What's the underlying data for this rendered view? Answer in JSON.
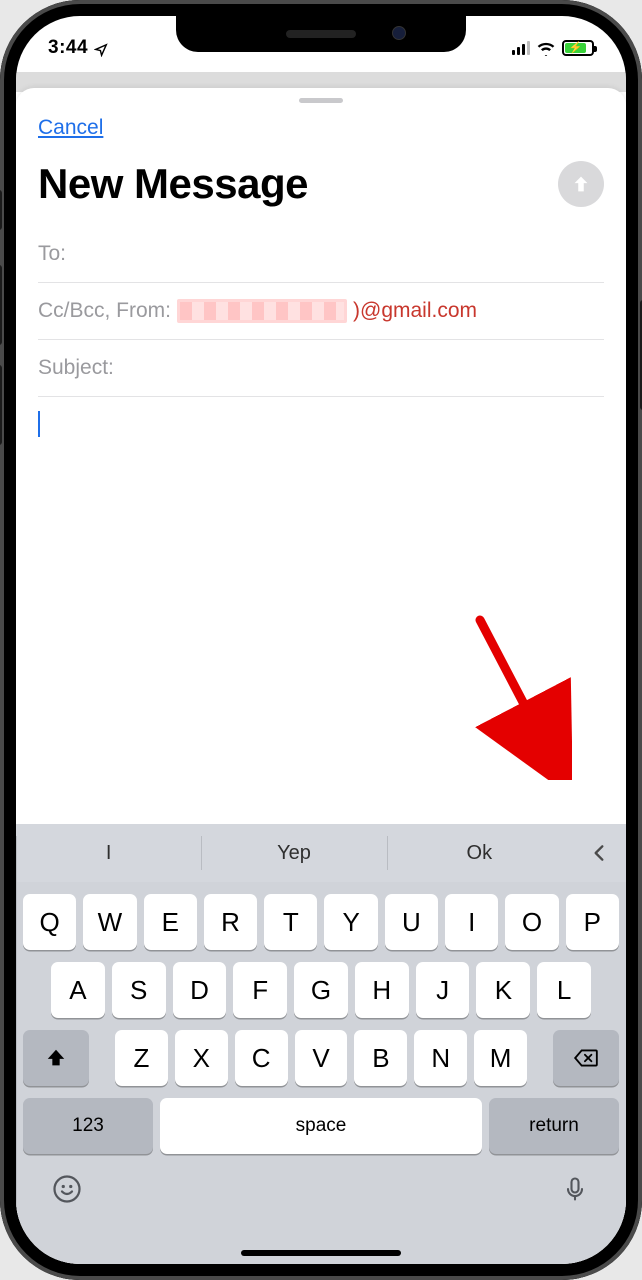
{
  "status": {
    "time": "3:44"
  },
  "sheet": {
    "cancel_label": "Cancel",
    "title": "New Message"
  },
  "fields": {
    "to_label": "To:",
    "ccbcc_from_label": "Cc/Bcc, From:",
    "from_domain_suffix": ")@gmail.com",
    "subject_label": "Subject:"
  },
  "suggestions": [
    "I",
    "Yep",
    "Ok"
  ],
  "keyboard": {
    "row1": [
      "Q",
      "W",
      "E",
      "R",
      "T",
      "Y",
      "U",
      "I",
      "O",
      "P"
    ],
    "row2": [
      "A",
      "S",
      "D",
      "F",
      "G",
      "H",
      "J",
      "K",
      "L"
    ],
    "row3": [
      "Z",
      "X",
      "C",
      "V",
      "B",
      "N",
      "M"
    ],
    "numbers_label": "123",
    "space_label": "space",
    "return_label": "return"
  }
}
